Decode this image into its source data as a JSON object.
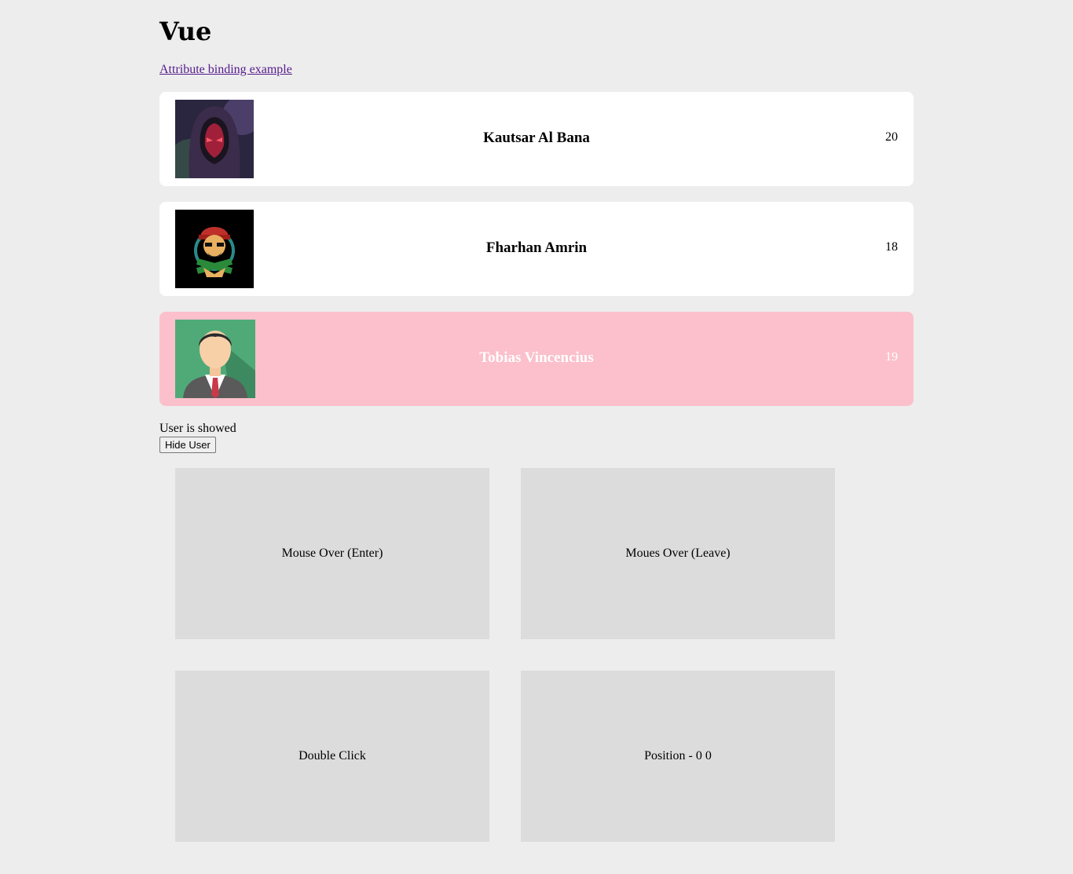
{
  "page": {
    "title": "Vue",
    "link_text": "Attribute binding example",
    "link_color": "#551a8b"
  },
  "users": [
    {
      "name": "Kautsar Al Bana",
      "age": "20",
      "avatar_icon": "hooded-mask-avatar",
      "highlight": false
    },
    {
      "name": "Fharhan Amrin",
      "age": "18",
      "avatar_icon": "gamer-mascot-avatar",
      "highlight": false
    },
    {
      "name": "Tobias Vincencius",
      "age": "19",
      "avatar_icon": "businessman-avatar",
      "highlight": true,
      "highlight_color": "#fbc0cb"
    }
  ],
  "status": {
    "text": "User is showed",
    "button_label": "Hide User"
  },
  "boxes": {
    "mouse_enter": "Mouse Over (Enter)",
    "mouse_leave": "Moues Over (Leave)",
    "double_click": "Double Click",
    "position": "Position - 0 0"
  }
}
